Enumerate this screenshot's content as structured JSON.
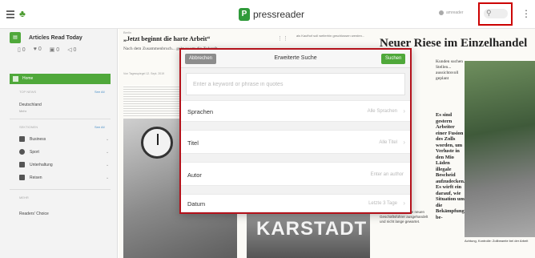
{
  "topbar": {
    "brand": "pressreader",
    "brand_mark": "P",
    "user_label": "amreader"
  },
  "sidebar": {
    "title": "Articles Read Today",
    "stats": [
      "0",
      "0",
      "0",
      "0"
    ],
    "home_label": "Home",
    "top_news_label": "TOP NEWS",
    "see_all": "See All",
    "region": "Deutschland",
    "region_sub": "Mehr",
    "sections_label": "SEKTIONEN",
    "categories": [
      "Business",
      "Sport",
      "Unterhaltung",
      "Reisen"
    ],
    "more_label": "MEHR",
    "readers_choice": "Readers' Choice"
  },
  "article": {
    "kicker": "Berlin",
    "headline_left": "„Jetzt beginnt die harte Arbeit“",
    "lead_left": "Nach dem Zusammenbruch... geht es um die Zukunft",
    "byline": "Von Tagesspiegel 12. Sept. 2019",
    "snippet_right": "als Kaufhof soll weiterhin geschlossen werden...",
    "headline_big": "Neuer Riese im Einzelhandel",
    "col3": "Kunden suchen Stellen... aussichtsvoll geplant",
    "col3_bold": "Es sind gestern Arbeiter einer Fusion des Zolls worden, um Verluste in den Mio Läden illegale Bescheid aufzudecken. Es wirft ein darauf, wie Situation um die Bekämpfung be-",
    "small_right": "BERLIN Es hat seine neuen Geschäftsführer ausgehandelt und nicht lange gewartet.",
    "caption_right": "Achtung, Kontrolle: Zollbeamte bei der Arbeit",
    "photo_text": "KARSTADT"
  },
  "modal": {
    "cancel_label": "Abbrechen",
    "title": "Erweiterte Suche",
    "search_label": "Suchen",
    "keyword_placeholder": "Enter a keyword or phrase in quotes",
    "rows": [
      {
        "label": "Sprachen",
        "value": "Alle Sprachen"
      },
      {
        "label": "Titel",
        "value": "Alle Titel"
      },
      {
        "label": "Autor",
        "value": "Enter an author"
      },
      {
        "label": "Datum",
        "value": "Letzte 3 Tage"
      }
    ]
  }
}
